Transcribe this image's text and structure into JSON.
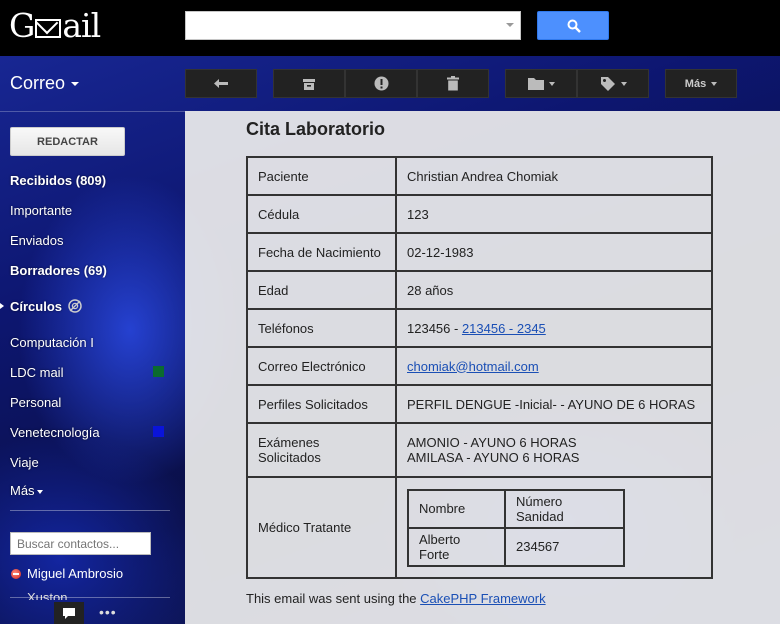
{
  "app": {
    "logo_text_left": "G",
    "logo_text_right": "ail"
  },
  "search": {
    "value": "",
    "placeholder": ""
  },
  "toolbar": {
    "mail_label": "Correo",
    "more_label": "Más"
  },
  "sidebar": {
    "compose_label": "REDACTAR",
    "items": [
      {
        "label": "Recibidos (809)",
        "bold": true
      },
      {
        "label": "Importante"
      },
      {
        "label": "Enviados"
      },
      {
        "label": "Borradores (69)",
        "bold": true
      },
      {
        "label": "Círculos",
        "bold": true
      },
      {
        "label": "Computación I"
      },
      {
        "label": "LDC mail",
        "color": "#0b6b2e"
      },
      {
        "label": "Personal"
      },
      {
        "label": "Venetecnología",
        "color": "#0a14d9"
      },
      {
        "label": "Viaje"
      },
      {
        "label": "Más"
      }
    ],
    "contacts_placeholder": "Buscar contactos...",
    "contacts": [
      "Miguel Ambrosio",
      "Xuston"
    ]
  },
  "message": {
    "title": "Cita Laboratorio",
    "rows": {
      "paciente": {
        "label": "Paciente",
        "value": "Christian Andrea Chomiak"
      },
      "cedula": {
        "label": "Cédula",
        "value": "123"
      },
      "fecha": {
        "label": "Fecha de Nacimiento",
        "value": "02-12-1983"
      },
      "edad": {
        "label": "Edad",
        "value": "28 años"
      },
      "telefonos": {
        "label": "Teléfonos",
        "value_plain": "123456 - ",
        "value_link": "213456 - 2345"
      },
      "correo": {
        "label": "Correo Electrónico",
        "value_link": "chomiak@hotmail.com"
      },
      "perfiles": {
        "label": "Perfiles Solicitados",
        "value": "PERFIL DENGUE -Inicial- - AYUNO DE 6 HORAS"
      },
      "examenes": {
        "label": "Exámenes Solicitados",
        "line1": "AMONIO - AYUNO 6 HORAS",
        "line2": "AMILASA - AYUNO 6 HORAS"
      },
      "medico": {
        "label": "Médico Tratante",
        "headers": [
          "Nombre",
          "Número Sanidad"
        ],
        "values": [
          "Alberto Forte",
          "234567"
        ]
      }
    },
    "footer_text": "This email was sent using the ",
    "footer_link": "CakePHP Framework"
  }
}
